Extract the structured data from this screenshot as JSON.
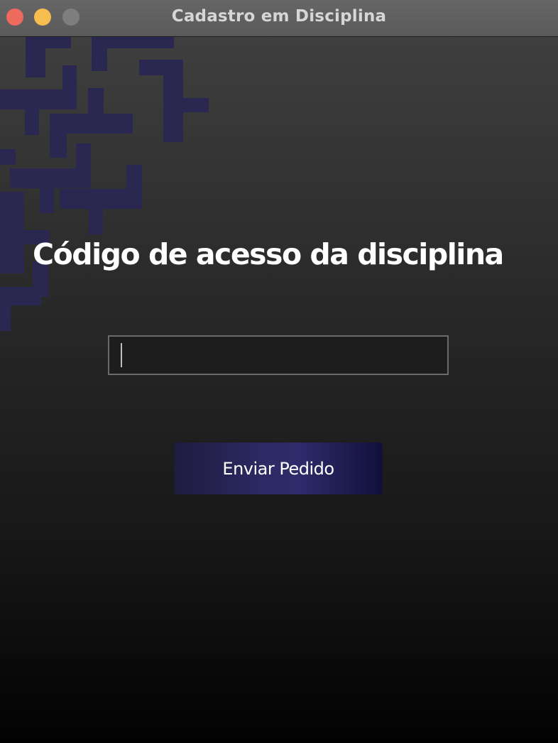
{
  "window": {
    "title": "Cadastro em Disciplina"
  },
  "form": {
    "heading": "Código de acesso da disciplina",
    "access_code_value": "",
    "submit_label": "Enviar Pedido"
  },
  "colors": {
    "accent_purple": "#2d2a66",
    "pattern_purple": "#2a2850"
  },
  "icons": {
    "close": "close-icon",
    "minimize": "minimize-icon",
    "zoom": "zoom-icon"
  }
}
